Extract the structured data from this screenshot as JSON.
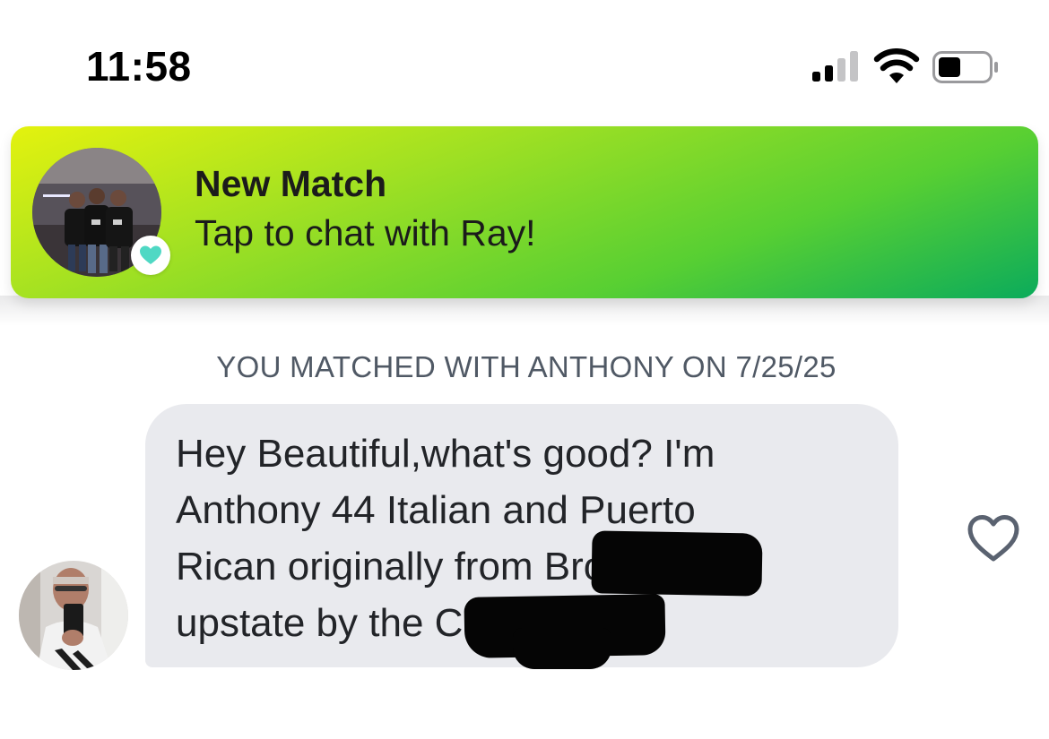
{
  "status_bar": {
    "time": "11:58",
    "icons": [
      "cellular-signal-icon",
      "wifi-icon",
      "battery-icon"
    ]
  },
  "notification": {
    "title": "New Match",
    "subtitle": "Tap to chat with Ray!",
    "badge_icon": "heart-icon",
    "colors": {
      "gradient_start": "#e4f20e",
      "gradient_end": "#0bab5b",
      "badge_heart": "#4fd8c4"
    }
  },
  "conversation": {
    "match_notice": "YOU MATCHED WITH ANTHONY ON 7/25/25",
    "messages": [
      {
        "text": "Hey Beautiful,what's good? I'm\nAnthony 44 Italian and Puerto\nRican originally from Bro      n now\nupstate by the Cat    ills.",
        "like_icon": "heart-outline-icon"
      }
    ]
  },
  "colors": {
    "bubble_bg": "#e9eaee",
    "match_notice_text": "#505965"
  }
}
